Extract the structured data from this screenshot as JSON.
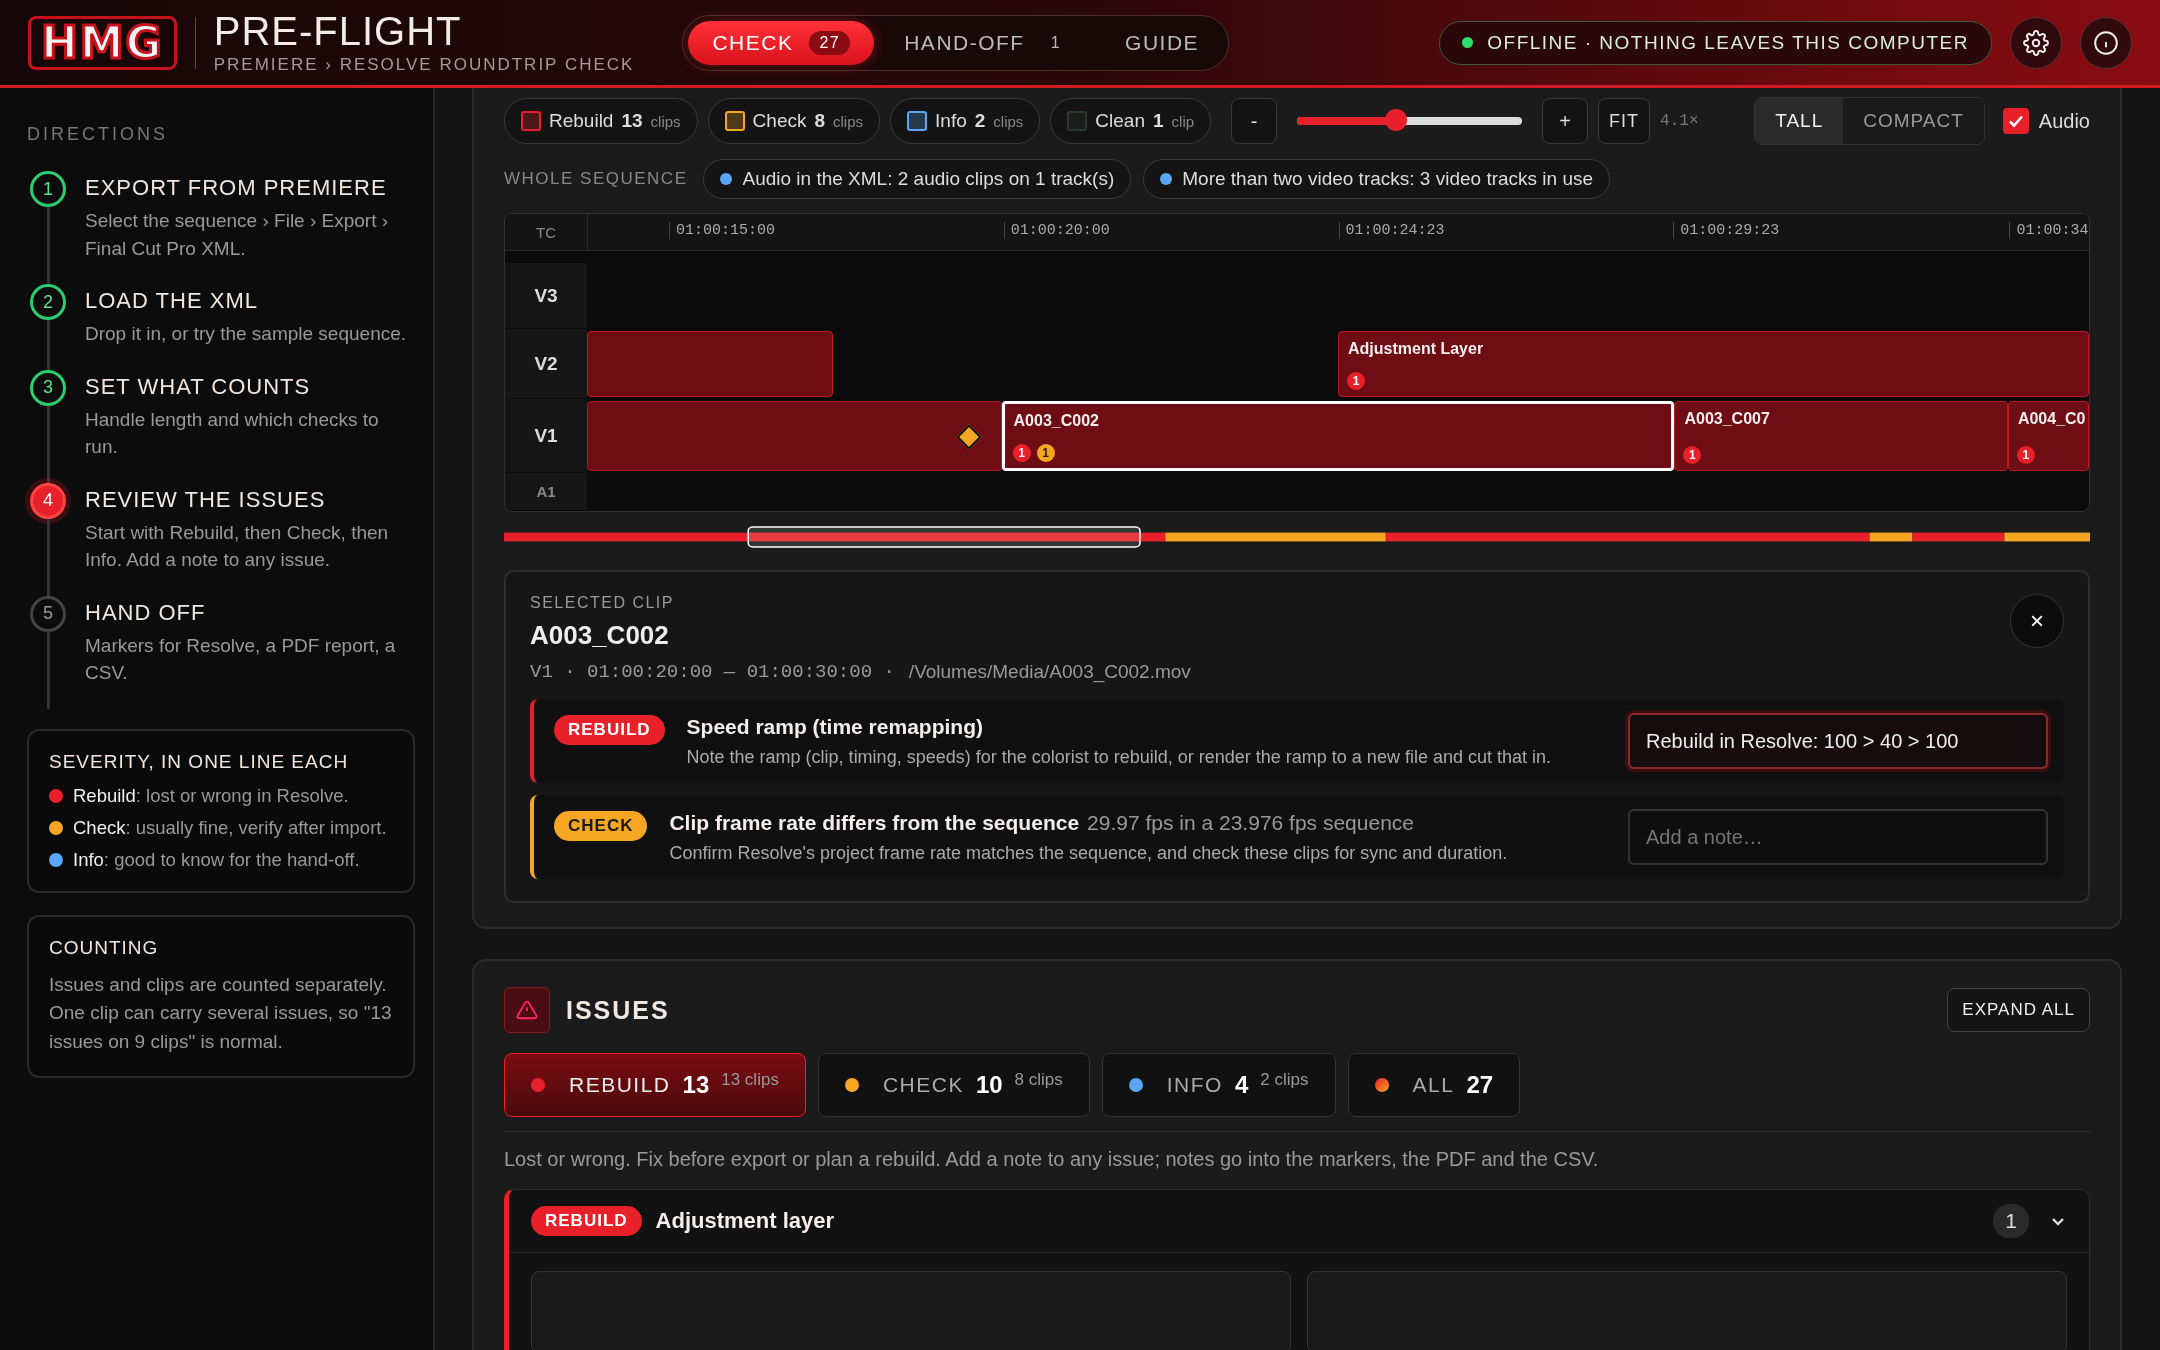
{
  "header": {
    "logo": "HMG",
    "title": "PRE-FLIGHT",
    "subtitle": "PREMIERE › RESOLVE ROUNDTRIP CHECK",
    "tabs": [
      {
        "label": "CHECK",
        "count": "27",
        "selected": true
      },
      {
        "label": "HAND-OFF",
        "count": "1",
        "selected": false
      },
      {
        "label": "GUIDE",
        "selected": false
      }
    ],
    "status": "OFFLINE · NOTHING LEAVES THIS COMPUTER"
  },
  "sidebar": {
    "heading": "DIRECTIONS",
    "steps": [
      {
        "number": "1",
        "title": "EXPORT FROM PREMIERE",
        "text": "Select the sequence › File › Export › Final Cut Pro XML.",
        "kind": "done"
      },
      {
        "number": "2",
        "title": "LOAD THE XML",
        "text": "Drop it in, or try the sample sequence.",
        "kind": "done"
      },
      {
        "number": "3",
        "title": "SET WHAT COUNTS",
        "text": "Handle length and which checks to run.",
        "kind": "done"
      },
      {
        "number": "4",
        "title": "REVIEW THE ISSUES",
        "text": "Start with Rebuild, then Check, then Info. Add a note to any issue.",
        "kind": "current"
      },
      {
        "number": "5",
        "title": "HAND OFF",
        "text": "Markers for Resolve, a PDF report, a CSV.",
        "kind": "todo"
      }
    ],
    "severity_card": {
      "title": "SEVERITY, IN ONE LINE EACH",
      "items": [
        {
          "label": "Rebuild",
          "text": ": lost or wrong in Resolve.",
          "color": "#e8202a"
        },
        {
          "label": "Check",
          "text": ": usually fine, verify after import.",
          "color": "#f5a623"
        },
        {
          "label": "Info",
          "text": ": good to know for the hand-off.",
          "color": "#5aa6f5"
        }
      ]
    },
    "counting_card": {
      "title": "COUNTING",
      "text": "Issues and clips are counted separately. One clip can carry several issues, so \"13 issues on 9 clips\" is normal."
    }
  },
  "toolbar": {
    "filters": [
      {
        "label": "Rebuild",
        "count": "13",
        "unit": "clips",
        "kind": "rebuild"
      },
      {
        "label": "Check",
        "count": "8",
        "unit": "clips",
        "kind": "check"
      },
      {
        "label": "Info",
        "count": "2",
        "unit": "clips",
        "kind": "info"
      },
      {
        "label": "Clean",
        "count": "1",
        "unit": "clip",
        "kind": "clean"
      }
    ],
    "zoom_out": "-",
    "zoom_in": "+",
    "fit": "FIT",
    "zoom": {
      "level": 0.44,
      "reading": "4.1×"
    },
    "views": [
      {
        "label": "TALL",
        "selected": true
      },
      {
        "label": "COMPACT",
        "selected": false
      }
    ],
    "audio": {
      "label": "Audio",
      "checked": true
    }
  },
  "sequence": {
    "label": "WHOLE SEQUENCE",
    "notes": [
      {
        "text": "Audio in the XML: 2 audio clips on 1 track(s)",
        "kind": "info"
      },
      {
        "text": "More than two video tracks: 3 video tracks in use",
        "kind": "info"
      }
    ]
  },
  "timeline": {
    "corner": "TC",
    "ticks": [
      "01:00:15:00",
      "01:00:20:00",
      "01:00:24:23",
      "01:00:29:23",
      "01:00:34"
    ],
    "tracks": [
      {
        "name": "V3"
      },
      {
        "name": "V2",
        "clips": [
          {
            "selected": false
          },
          {
            "title": "Adjustment Layer",
            "selected": false,
            "badges": [
              {
                "count": "1",
                "kind": "rebuild"
              }
            ]
          }
        ]
      },
      {
        "name": "V1",
        "clips": [
          {
            "selected": false,
            "markers": [
              {
                "kind": "check"
              }
            ]
          },
          {
            "title": "A003_C002",
            "selected": true,
            "badges": [
              {
                "count": "1",
                "kind": "rebuild"
              },
              {
                "count": "1",
                "kind": "check"
              }
            ]
          },
          {
            "title": "A003_C007",
            "selected": false,
            "badges": [
              {
                "count": "1",
                "kind": "rebuild"
              }
            ]
          },
          {
            "title": "A004_C0",
            "selected": false,
            "badges": [
              {
                "count": "1",
                "kind": "rebuild"
              }
            ]
          }
        ]
      },
      {
        "name": "A1"
      }
    ]
  },
  "selected_clip": {
    "label": "SELECTED CLIP",
    "name": "A003_C002",
    "meta": "V1 · 01:00:20:00 — 01:00:30:00 ·",
    "path": "/Volumes/Media/A003_C002.mov",
    "close": "×",
    "issues": [
      {
        "kind": "rebuild",
        "tag": "REBUILD",
        "title": "Speed ramp (time remapping)",
        "text": "Note the ramp (clip, timing, speeds) for the colorist to rebuild, or render the ramp to a new file and cut that in.",
        "note": "Rebuild in Resolve: 100 > 40 > 100"
      },
      {
        "kind": "check",
        "tag": "CHECK",
        "title": "Clip frame rate differs from the sequence",
        "detail": "29.97 fps in a 23.976 fps sequence",
        "text": "Confirm Resolve's project frame rate matches the sequence, and check these clips for sync and duration.",
        "placeholder": "Add a note…"
      }
    ]
  },
  "issues": {
    "title": "ISSUES",
    "expand": "EXPAND ALL",
    "tabs": [
      {
        "label": "REBUILD",
        "count": "13",
        "clips": "13 clips",
        "kind": "rebuild",
        "selected": true
      },
      {
        "label": "CHECK",
        "count": "10",
        "clips": "8 clips",
        "kind": "check",
        "selected": false
      },
      {
        "label": "INFO",
        "count": "4",
        "clips": "2 clips",
        "kind": "info",
        "selected": false
      },
      {
        "label": "ALL",
        "count": "27",
        "kind": "all",
        "selected": false
      }
    ],
    "description": "Lost or wrong. Fix before export or plan a rebuild. Add a note to any issue; notes go into the markers, the PDF and the CSV.",
    "groups": [
      {
        "kind": "rebuild",
        "tag": "REBUILD",
        "title": "Adjustment layer",
        "count": "1",
        "expanded": true
      }
    ]
  }
}
